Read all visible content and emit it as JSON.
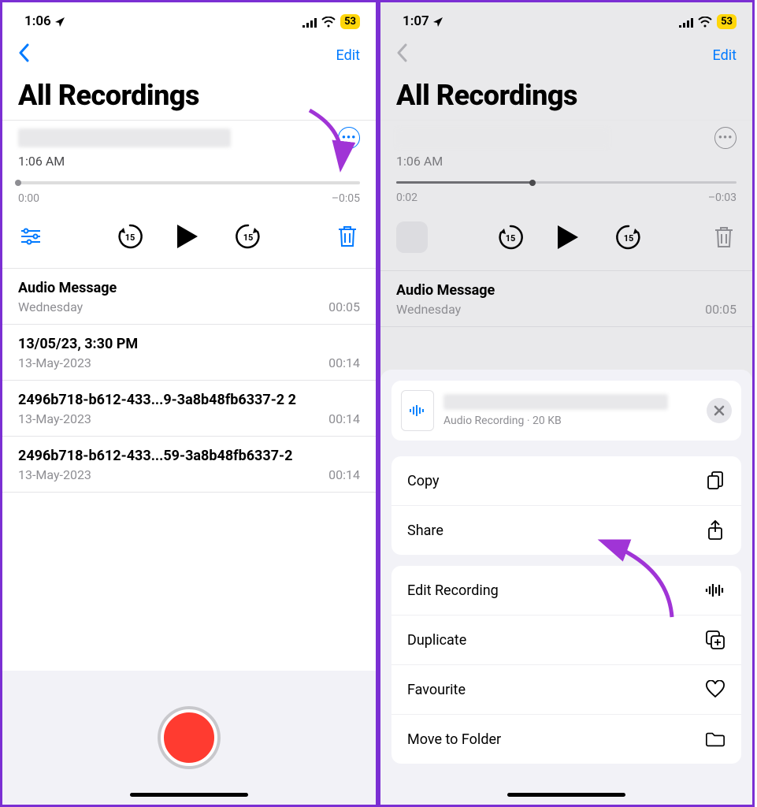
{
  "left": {
    "status": {
      "time": "1:06",
      "battery": "53"
    },
    "nav": {
      "edit": "Edit"
    },
    "title": "All Recordings",
    "selected": {
      "time": "1:06 AM",
      "start": "0:00",
      "end": "–0:05",
      "progress_pct": 0
    },
    "list": [
      {
        "title": "Audio Message",
        "sub": "Wednesday",
        "dur": "00:05"
      },
      {
        "title": "13/05/23, 3:30 PM",
        "sub": "13-May-2023",
        "dur": "00:14"
      },
      {
        "title": "2496b718-b612-433...9-3a8b48fb6337-2 2",
        "sub": "13-May-2023",
        "dur": "00:14"
      },
      {
        "title": "2496b718-b612-433...59-3a8b48fb6337-2",
        "sub": "13-May-2023",
        "dur": "00:14"
      }
    ]
  },
  "right": {
    "status": {
      "time": "1:07",
      "battery": "53"
    },
    "nav": {
      "edit": "Edit"
    },
    "title": "All Recordings",
    "selected": {
      "time": "1:06 AM",
      "start": "0:02",
      "end": "–0:03",
      "progress_pct": 40
    },
    "list": [
      {
        "title": "Audio Message",
        "sub": "Wednesday",
        "dur": "00:05"
      }
    ],
    "sheet": {
      "file_sub": "Audio Recording · 20 KB",
      "group1": [
        {
          "label": "Copy",
          "icon": "copy"
        },
        {
          "label": "Share",
          "icon": "share"
        }
      ],
      "group2": [
        {
          "label": "Edit Recording",
          "icon": "waveform"
        },
        {
          "label": "Duplicate",
          "icon": "duplicate"
        },
        {
          "label": "Favourite",
          "icon": "heart"
        },
        {
          "label": "Move to Folder",
          "icon": "folder"
        }
      ]
    }
  }
}
